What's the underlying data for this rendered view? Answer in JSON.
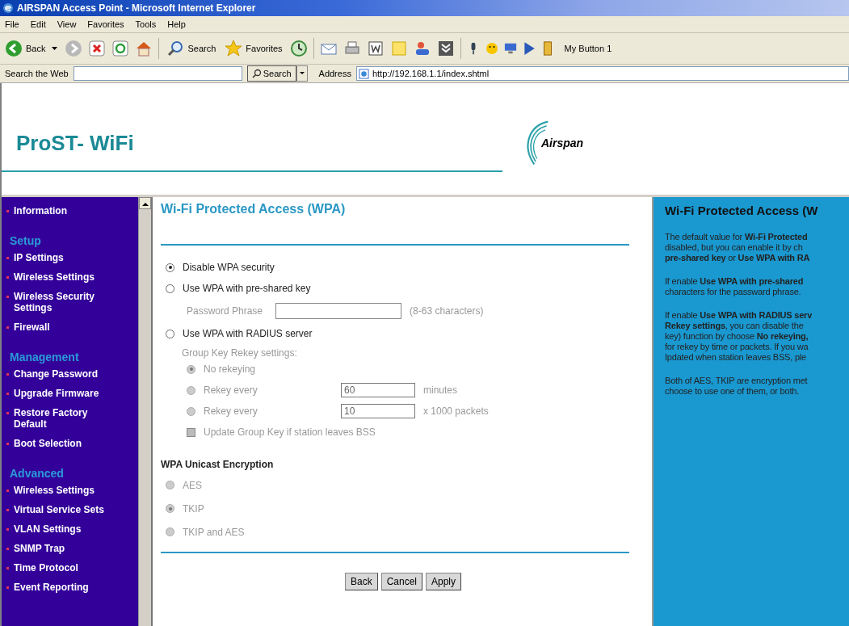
{
  "browser": {
    "title": "AIRSPAN Access Point - Microsoft Internet Explorer",
    "menu": [
      "File",
      "Edit",
      "View",
      "Favorites",
      "Tools",
      "Help"
    ],
    "toolbar": {
      "back": "Back",
      "search": "Search",
      "favorites": "Favorites",
      "custom": "My Button 1"
    },
    "search_bar": {
      "label": "Search the Web",
      "button": "Search"
    },
    "address": {
      "label": "Address",
      "value": "http://192.168.1.1/index.shtml"
    }
  },
  "header": {
    "product": "ProST- WiFi",
    "logo": "Airspan"
  },
  "sidebar": [
    {
      "kind": "link",
      "label": "Information"
    },
    {
      "kind": "heading",
      "label": "Setup"
    },
    {
      "kind": "link",
      "label": "IP Settings"
    },
    {
      "kind": "link",
      "label": "Wireless Settings"
    },
    {
      "kind": "link",
      "label": "Wireless Security Settings"
    },
    {
      "kind": "link",
      "label": "Firewall"
    },
    {
      "kind": "heading",
      "label": "Management"
    },
    {
      "kind": "link",
      "label": "Change Password"
    },
    {
      "kind": "link",
      "label": "Upgrade Firmware"
    },
    {
      "kind": "link",
      "label": "Restore Factory Default"
    },
    {
      "kind": "link",
      "label": "Boot Selection"
    },
    {
      "kind": "heading",
      "label": "Advanced"
    },
    {
      "kind": "link",
      "label": "Wireless Settings"
    },
    {
      "kind": "link",
      "label": "Virtual Service Sets"
    },
    {
      "kind": "link",
      "label": "VLAN Settings"
    },
    {
      "kind": "link",
      "label": "SNMP Trap"
    },
    {
      "kind": "link",
      "label": "Time Protocol"
    },
    {
      "kind": "link",
      "label": "Event Reporting"
    }
  ],
  "main": {
    "title": "Wi-Fi Protected Access (WPA)",
    "security_options": [
      {
        "label": "Disable WPA security",
        "selected": true
      },
      {
        "label": "Use WPA with pre-shared key",
        "selected": false
      },
      {
        "label": "Use WPA with RADIUS server",
        "selected": false
      }
    ],
    "password": {
      "label": "Password Phrase",
      "hint": "(8-63 characters)"
    },
    "rekey": {
      "label": "Group Key Rekey settings:",
      "options": [
        {
          "label": "No rekeying",
          "selected": true,
          "disabled": true
        },
        {
          "label": "Rekey every",
          "selected": false,
          "disabled": true,
          "value": "60",
          "unit": "minutes"
        },
        {
          "label": "Rekey every",
          "selected": false,
          "disabled": true,
          "value": "10",
          "unit": "x 1000 packets"
        }
      ]
    },
    "update_group_key": {
      "label": "Update Group Key if station leaves BSS",
      "checked": false,
      "disabled": true
    },
    "unicast": {
      "title": "WPA Unicast Encryption",
      "options": [
        {
          "label": "AES",
          "selected": false,
          "disabled": true
        },
        {
          "label": "TKIP",
          "selected": true,
          "disabled": true
        },
        {
          "label": "TKIP and AES",
          "selected": false,
          "disabled": true
        }
      ]
    },
    "buttons": [
      "Back",
      "Cancel",
      "Apply"
    ]
  },
  "help": {
    "title": "Wi-Fi Protected Access (W",
    "paragraphs": [
      [
        "The default value for **Wi-Fi Protected**",
        "disabled, but you can enable it by ch",
        "**pre-shared key** or **Use WPA with RA**"
      ],
      [
        "If enable **Use WPA with pre-shared**",
        "characters for the passward phrase."
      ],
      [
        "If enable **Use WPA with RADIUS serv**",
        "**Rekey settings**, you can disable the",
        "key) function by choose **No rekeying,**",
        "for rekey by time or packets. If you wa",
        "Ipdated when station leaves BSS, ple"
      ],
      [
        "Both of AES, TKIP are encryption met",
        "choose to use one of them, or both."
      ]
    ]
  }
}
